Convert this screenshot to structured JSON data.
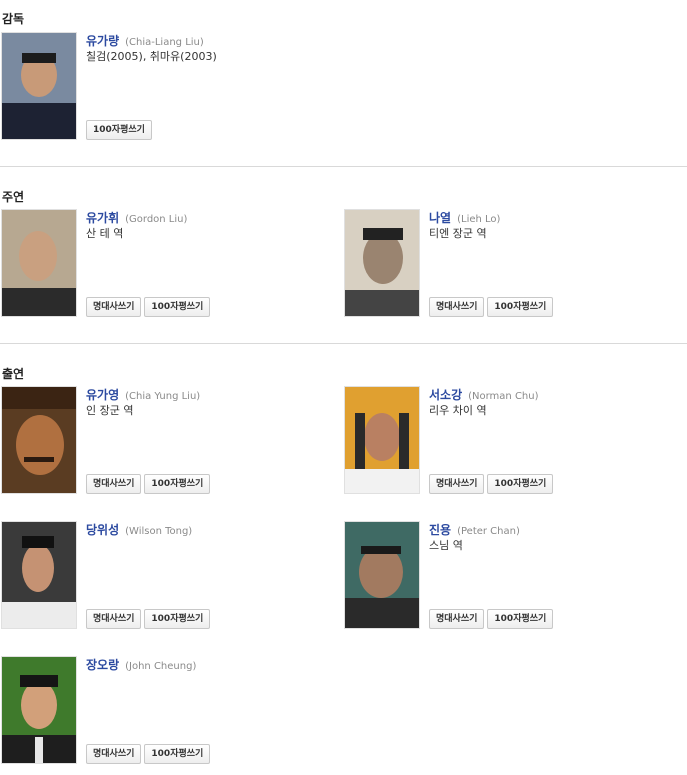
{
  "sections": {
    "director": "감독",
    "lead": "주연",
    "supporting": "출연"
  },
  "buttons": {
    "quote": "명대사쓰기",
    "review": "100자평쓰기"
  },
  "people": {
    "director1": {
      "name": "유가량",
      "eng": "(Chia-Liang Liu)",
      "role": "칠검(2005), 취마유(2003)"
    },
    "lead1": {
      "name": "유가휘",
      "eng": "(Gordon Liu)",
      "role": "산 테 역"
    },
    "lead2": {
      "name": "나열",
      "eng": "(Lieh Lo)",
      "role": "티엔 장군 역"
    },
    "sup1": {
      "name": "유가영",
      "eng": "(Chia Yung Liu)",
      "role": "인 장군 역"
    },
    "sup2": {
      "name": "서소강",
      "eng": "(Norman Chu)",
      "role": "리우 차이 역"
    },
    "sup3": {
      "name": "당위성",
      "eng": "(Wilson Tong)",
      "role": ""
    },
    "sup4": {
      "name": "진용",
      "eng": "(Peter Chan)",
      "role": "스님 역"
    },
    "sup5": {
      "name": "장오랑",
      "eng": "(John Cheung)",
      "role": ""
    }
  }
}
